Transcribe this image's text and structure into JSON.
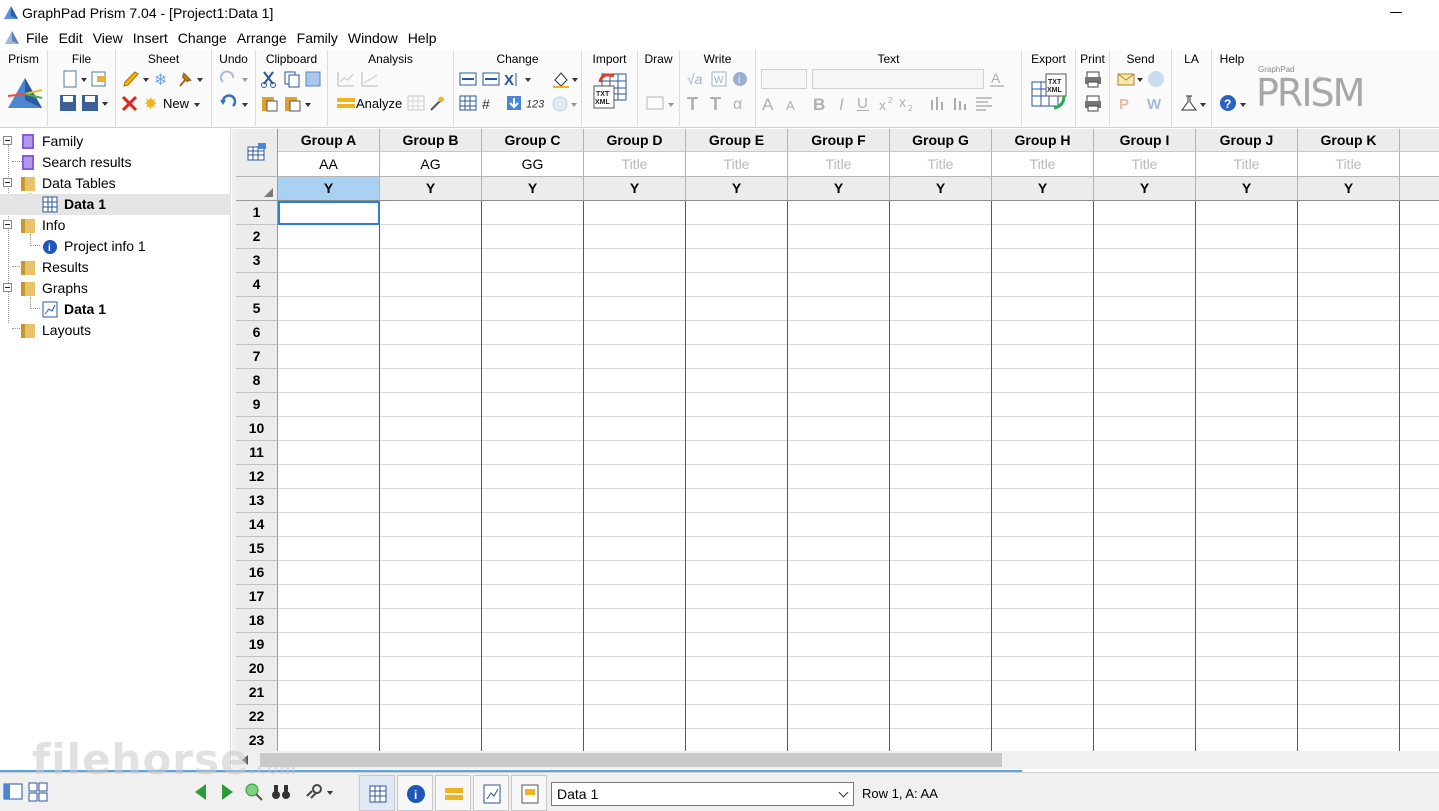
{
  "window": {
    "title": "GraphPad Prism 7.04 - [Project1:Data 1]"
  },
  "menu": [
    "File",
    "Edit",
    "View",
    "Insert",
    "Change",
    "Arrange",
    "Family",
    "Window",
    "Help"
  ],
  "ribbon": {
    "groups": {
      "prism": "Prism",
      "file": "File",
      "sheet": "Sheet",
      "undo": "Undo",
      "clipboard": "Clipboard",
      "analysis": "Analysis",
      "change": "Change",
      "import": "Import",
      "draw": "Draw",
      "write": "Write",
      "text": "Text",
      "export": "Export",
      "print": "Print",
      "send": "Send",
      "la": "LA",
      "help": "Help"
    },
    "new_label": "New",
    "analyze_label": "Analyze",
    "logo_small": "GraphPad",
    "logo_big": "PRISM",
    "logo_reg": "®"
  },
  "navigator": {
    "items": [
      {
        "label": "Family",
        "bold": false,
        "selected": false
      },
      {
        "label": "Search results",
        "bold": false,
        "selected": false
      },
      {
        "label": "Data Tables",
        "bold": false,
        "selected": false
      },
      {
        "label": "Data 1",
        "bold": true,
        "selected": true
      },
      {
        "label": "Info",
        "bold": false,
        "selected": false
      },
      {
        "label": "Project info 1",
        "bold": false,
        "selected": false
      },
      {
        "label": "Results",
        "bold": false,
        "selected": false
      },
      {
        "label": "Graphs",
        "bold": false,
        "selected": false
      },
      {
        "label": "Data 1",
        "bold": true,
        "selected": false
      },
      {
        "label": "Layouts",
        "bold": false,
        "selected": false
      }
    ]
  },
  "sheet": {
    "columns": [
      {
        "group": "Group A",
        "title": "AA",
        "placeholder": false,
        "sub": "Y"
      },
      {
        "group": "Group B",
        "title": "AG",
        "placeholder": false,
        "sub": "Y"
      },
      {
        "group": "Group C",
        "title": "GG",
        "placeholder": false,
        "sub": "Y"
      },
      {
        "group": "Group D",
        "title": "Title",
        "placeholder": true,
        "sub": "Y"
      },
      {
        "group": "Group E",
        "title": "Title",
        "placeholder": true,
        "sub": "Y"
      },
      {
        "group": "Group F",
        "title": "Title",
        "placeholder": true,
        "sub": "Y"
      },
      {
        "group": "Group G",
        "title": "Title",
        "placeholder": true,
        "sub": "Y"
      },
      {
        "group": "Group H",
        "title": "Title",
        "placeholder": true,
        "sub": "Y"
      },
      {
        "group": "Group I",
        "title": "Title",
        "placeholder": true,
        "sub": "Y"
      },
      {
        "group": "Group J",
        "title": "Title",
        "placeholder": true,
        "sub": "Y"
      },
      {
        "group": "Group K",
        "title": "Title",
        "placeholder": true,
        "sub": "Y"
      },
      {
        "group": "Gr",
        "title": "T",
        "placeholder": true,
        "sub": ""
      }
    ],
    "rows": [
      "1",
      "2",
      "3",
      "4",
      "5",
      "6",
      "7",
      "8",
      "9",
      "10",
      "11",
      "12",
      "13",
      "14",
      "15",
      "16",
      "17",
      "18",
      "19",
      "20",
      "21",
      "22",
      "23"
    ],
    "active_row": "1",
    "active_column": "Group A"
  },
  "bottom": {
    "sheet_select_value": "Data 1",
    "status": "Row 1, A: AA"
  },
  "watermark": {
    "text": "filehorse",
    "suffix": ".com"
  }
}
